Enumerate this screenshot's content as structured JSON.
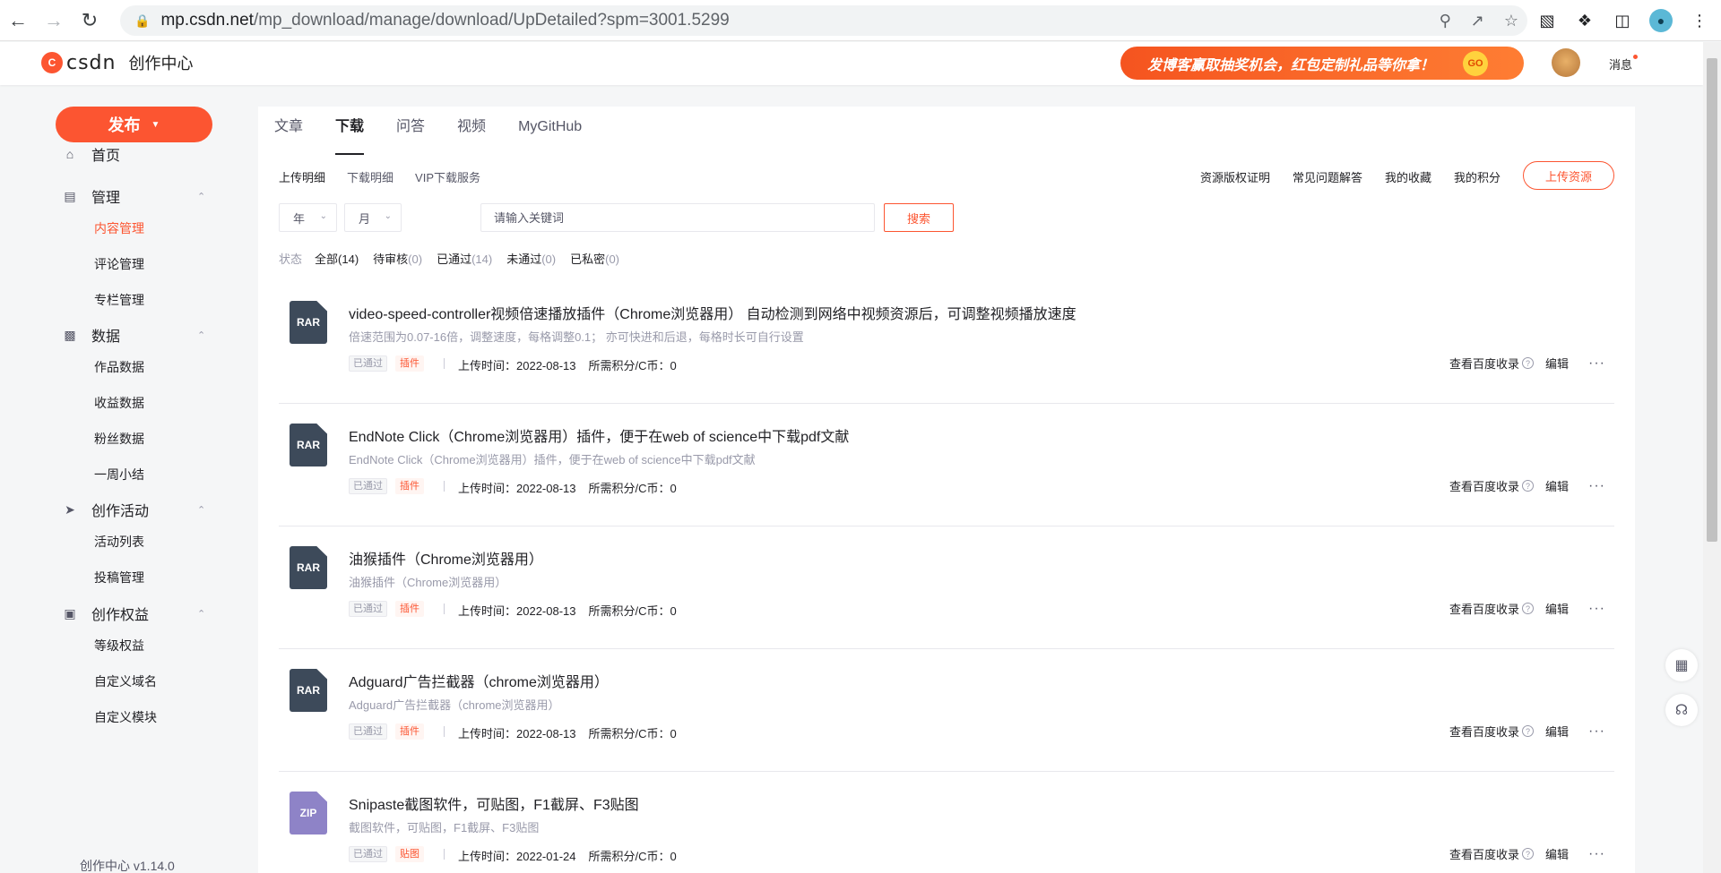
{
  "browser": {
    "url_host": "mp.csdn.net",
    "url_path": "/mp_download/manage/download/UpDetailed?spm=3001.5299"
  },
  "header": {
    "logo_text": "csdn",
    "logo_sub": "创作中心",
    "promo_text": "发博客赢取抽奖机会，红包定制礼品等你拿！",
    "promo_go": "GO",
    "messages": "消息"
  },
  "sidebar": {
    "publish": "发布",
    "home": "首页",
    "manage": "管理",
    "manage_items": [
      "内容管理",
      "评论管理",
      "专栏管理"
    ],
    "data": "数据",
    "data_items": [
      "作品数据",
      "收益数据",
      "粉丝数据",
      "一周小结"
    ],
    "activity": "创作活动",
    "activity_items": [
      "活动列表",
      "投稿管理"
    ],
    "rights": "创作权益",
    "rights_items": [
      "等级权益",
      "自定义域名",
      "自定义模块"
    ],
    "version": "创作中心 v1.14.0"
  },
  "tabs": [
    "文章",
    "下载",
    "问答",
    "视频",
    "MyGitHub"
  ],
  "subnav": [
    "上传明细",
    "下载明细",
    "VIP下载服务"
  ],
  "right_links": [
    "资源版权证明",
    "常见问题解答",
    "我的收藏",
    "我的积分"
  ],
  "upload_button": "上传资源",
  "filters": {
    "year": "年",
    "month": "月",
    "search_placeholder": "请输入关键词",
    "search_button": "搜索"
  },
  "status": {
    "label": "状态",
    "options": [
      {
        "label": "全部",
        "count": "(14)"
      },
      {
        "label": "待审核",
        "count": "(0)"
      },
      {
        "label": "已通过",
        "count": "(14)"
      },
      {
        "label": "未通过",
        "count": "(0)"
      },
      {
        "label": "已私密",
        "count": "(0)"
      }
    ]
  },
  "items": [
    {
      "type": "RAR",
      "title": "video-speed-controller视频倍速播放插件（Chrome浏览器用） 自动检测到网络中视频资源后，可调整视频播放速度",
      "desc": "倍速范围为0.07-16倍，调整速度，每格调整0.1； 亦可快进和后退，每格时长可自行设置",
      "status": "已通过",
      "category": "插件",
      "upload_time": "上传时间：2022-08-13",
      "points": "所需积分/C币：0"
    },
    {
      "type": "RAR",
      "title": "EndNote Click（Chrome浏览器用）插件，便于在web of science中下载pdf文献",
      "desc": "EndNote Click（Chrome浏览器用）插件，便于在web of science中下载pdf文献",
      "status": "已通过",
      "category": "插件",
      "upload_time": "上传时间：2022-08-13",
      "points": "所需积分/C币：0"
    },
    {
      "type": "RAR",
      "title": "油猴插件（Chrome浏览器用）",
      "desc": "油猴插件（Chrome浏览器用）",
      "status": "已通过",
      "category": "插件",
      "upload_time": "上传时间：2022-08-13",
      "points": "所需积分/C币：0"
    },
    {
      "type": "RAR",
      "title": "Adguard广告拦截器（chrome浏览器用）",
      "desc": "Adguard广告拦截器（chrome浏览器用）",
      "status": "已通过",
      "category": "插件",
      "upload_time": "上传时间：2022-08-13",
      "points": "所需积分/C币：0"
    },
    {
      "type": "ZIP",
      "title": "Snipaste截图软件，可贴图，F1截屏、F3贴图",
      "desc": "截图软件，可贴图，F1截屏、F3贴图",
      "status": "已通过",
      "category": "贴图",
      "upload_time": "上传时间：2022-01-24",
      "points": "所需积分/C币：0"
    }
  ],
  "item_actions": {
    "baidu": "查看百度收录",
    "help": "?",
    "edit": "编辑",
    "more": "···"
  }
}
